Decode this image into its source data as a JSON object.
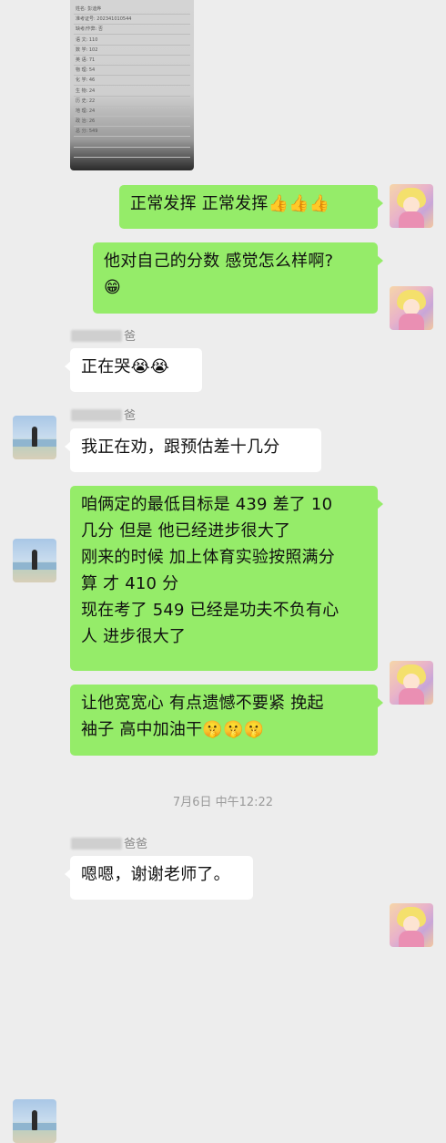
{
  "photo": {
    "rows": [
      "姓名:  彭迪烨",
      "准考证号:  202341010544",
      "缺考/作弊:  否",
      "语    文:  110",
      "数    学:  102",
      "英    语:  71",
      "物    理:  54",
      "化    学:  46",
      "生    物:  24",
      "历    史:  22",
      "地    理:  24",
      "政    治:  26",
      "总    分:  549",
      "",
      ""
    ]
  },
  "messages": [
    {
      "text": "正常发挥 正常发挥",
      "emoji": "👍👍👍"
    },
    {
      "line1": "他对自己的分数 感觉怎么样啊?",
      "emoji": "😁"
    },
    {
      "sender_suffix": "爸",
      "text": "正在哭",
      "emoji": "😭😭"
    },
    {
      "sender_suffix": "爸",
      "text": "我正在劝，跟预估差十几分"
    },
    {
      "lines": [
        "咱俩定的最低目标是 439 差了 10",
        "几分 但是 他已经进步很大了",
        "刚来的时候 加上体育实验按照满分",
        "算 才 410 分",
        "现在考了 549 已经是功夫不负有心",
        "人 进步很大了"
      ]
    },
    {
      "line1": "让他宽宽心 有点遗憾不要紧 挽起",
      "line2": "袖子 高中加油干",
      "emoji": "🤫🤫🤫"
    },
    {
      "sender_suffix": "爸爸",
      "text": "嗯嗯，谢谢老师了。"
    }
  ],
  "timestamp": "7月6日 中午12:22",
  "second_sender_suffix": "爸"
}
